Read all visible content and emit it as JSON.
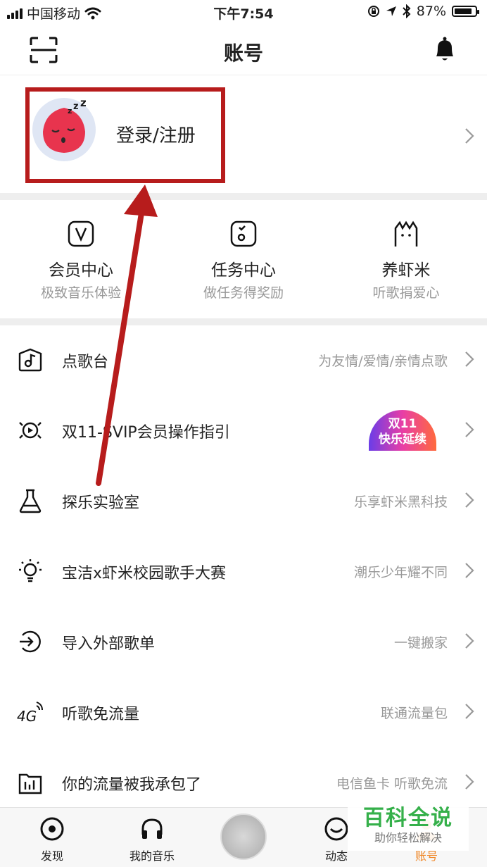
{
  "status": {
    "carrier": "中国移动",
    "time": "下午7:54",
    "battery": "87%",
    "battery_level": 0.87
  },
  "header": {
    "title": "账号"
  },
  "login": {
    "label": "登录/注册"
  },
  "quick_links": [
    {
      "title": "会员中心",
      "subtitle": "极致音乐体验",
      "icon": "vip-v-icon"
    },
    {
      "title": "任务中心",
      "subtitle": "做任务得奖励",
      "icon": "task-icon"
    },
    {
      "title": "养虾米",
      "subtitle": "听歌捐爱心",
      "icon": "shrimp-icon"
    }
  ],
  "menu": [
    {
      "label": "点歌台",
      "detail": "为友情/爱情/亲情点歌",
      "icon": "song-request-icon"
    },
    {
      "label": "双11-SVIP会员操作指引",
      "detail": "",
      "icon": "svip-guide-icon",
      "badge": [
        "双11",
        "快乐延续"
      ]
    },
    {
      "label": "探乐实验室",
      "detail": "乐享虾米黑科技",
      "icon": "flask-icon"
    },
    {
      "label": "宝洁x虾米校园歌手大赛",
      "detail": "潮乐少年耀不同",
      "icon": "lightbulb-icon"
    },
    {
      "label": "导入外部歌单",
      "detail": "一键搬家",
      "icon": "import-icon"
    },
    {
      "label": "听歌免流量",
      "detail": "联通流量包",
      "icon": "4g-icon"
    },
    {
      "label": "你的流量被我承包了",
      "detail": "电信鱼卡 听歌免流",
      "icon": "data-chart-icon"
    }
  ],
  "tabs": [
    {
      "label": "发现",
      "icon": "discover-icon"
    },
    {
      "label": "我的音乐",
      "icon": "headphones-icon"
    },
    {
      "label": "动态",
      "icon": "moments-icon"
    },
    {
      "label": "账号",
      "icon": "account-icon"
    }
  ],
  "watermark": {
    "title": "百科全说",
    "subtitle": "助你轻松解决"
  },
  "colors": {
    "highlight": "#b71c1c",
    "watermark": "#35b04a",
    "avatar": "#e8344e",
    "active_tab": "#f08a2c"
  }
}
